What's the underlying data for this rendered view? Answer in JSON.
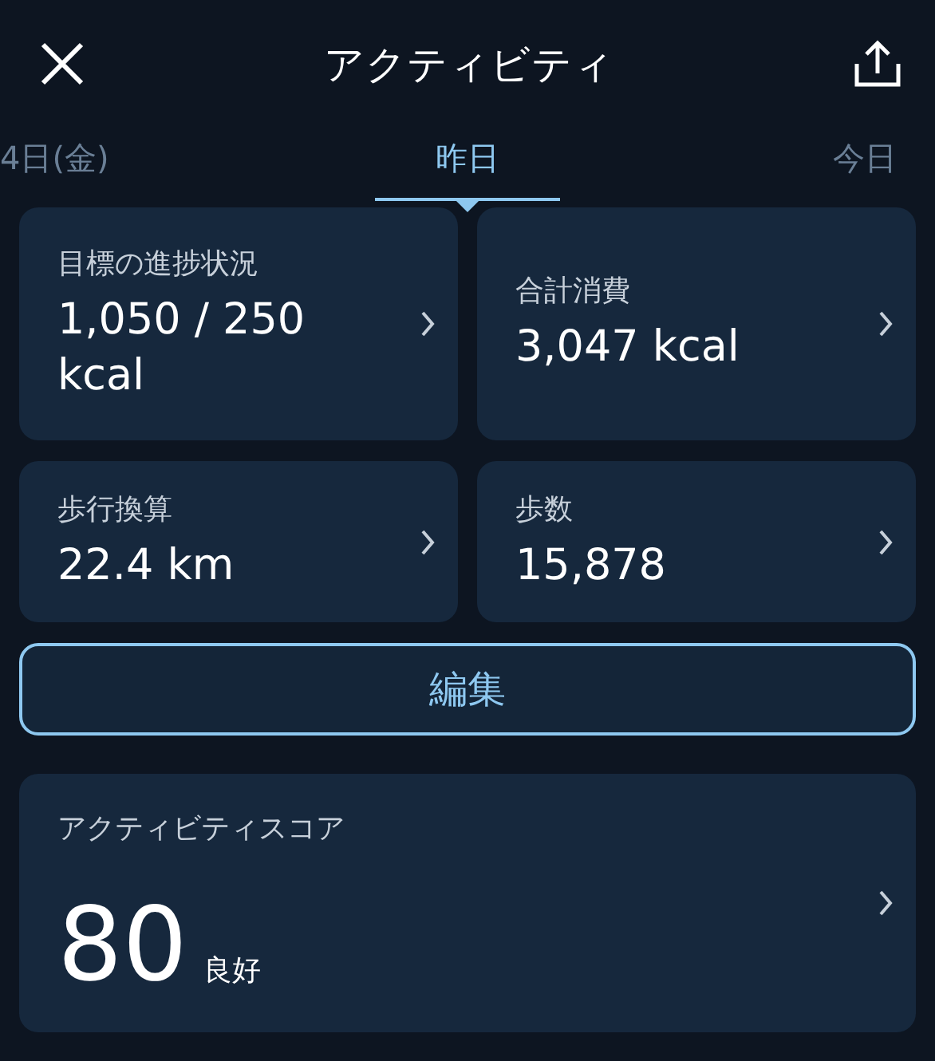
{
  "header": {
    "title": "アクティビティ"
  },
  "date_tabs": [
    {
      "label": "4日(金)",
      "selected": false
    },
    {
      "label": "昨日",
      "selected": true
    },
    {
      "label": "今日",
      "selected": false
    }
  ],
  "cards": [
    {
      "label": "目標の進捗状況",
      "value": "1,050 / 250 kcal"
    },
    {
      "label": "合計消費",
      "value": "3,047 kcal"
    },
    {
      "label": "歩行換算",
      "value": "22.4 km"
    },
    {
      "label": "歩数",
      "value": "15,878"
    }
  ],
  "edit_button": {
    "label": "編集"
  },
  "score_card": {
    "label": "アクティビティスコア",
    "score": "80",
    "rating": "良好"
  }
}
